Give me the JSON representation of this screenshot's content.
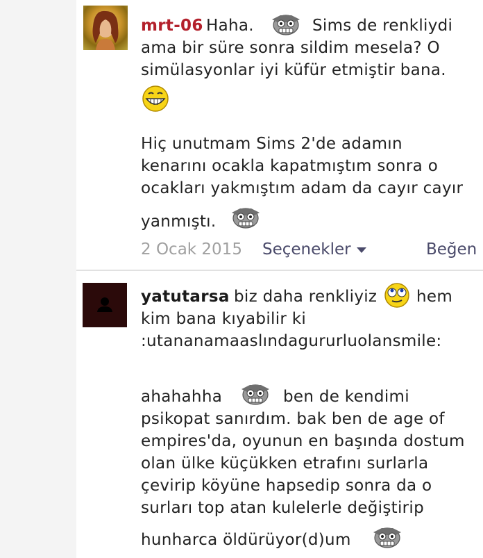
{
  "comments": [
    {
      "username": "mrt-06",
      "lines": [
        "Haha.",
        "Sims de renkliydi",
        "ama bir süre sonra sildim mesela? O",
        "simülasyonlar iyi küfür etmiştir bana.",
        "Hiç unutmam Sims 2'de adamın",
        "kenarını ocakla kapatmıştım sonra o",
        "ocakları yakmıştım adam da cayır cayır",
        "yanmıştı."
      ],
      "date": "2 Ocak 2015",
      "options_label": "Seçenekler",
      "like_label": "Beğen"
    },
    {
      "username": "yatutarsa",
      "lines": [
        "biz daha renkliyiz",
        "hem",
        "kim bana kıyabilir ki",
        ":utananamaaslındagururluolansmile:",
        "ahahahha",
        "ben de kendimi",
        "psikopat sanırdım. bak ben de age of",
        "empires'da, oyunun en başında dostum",
        "olan ülke küçükken etrafını surlarla",
        "çevirip köyüne hapsedip sonra da o",
        "surları top atan kulelerle değiştirip",
        "hunharca öldürüyor(d)um"
      ]
    }
  ],
  "colors": {
    "username1": "#b3202b",
    "username2": "#1a1a1a",
    "date": "#a0a0a0",
    "link": "#4a4a6a"
  },
  "icons": [
    "robot-smiley-icon",
    "grin-smiley-icon",
    "rolling-eyes-smiley-icon",
    "person-silhouette-icon",
    "chevron-down-icon"
  ]
}
